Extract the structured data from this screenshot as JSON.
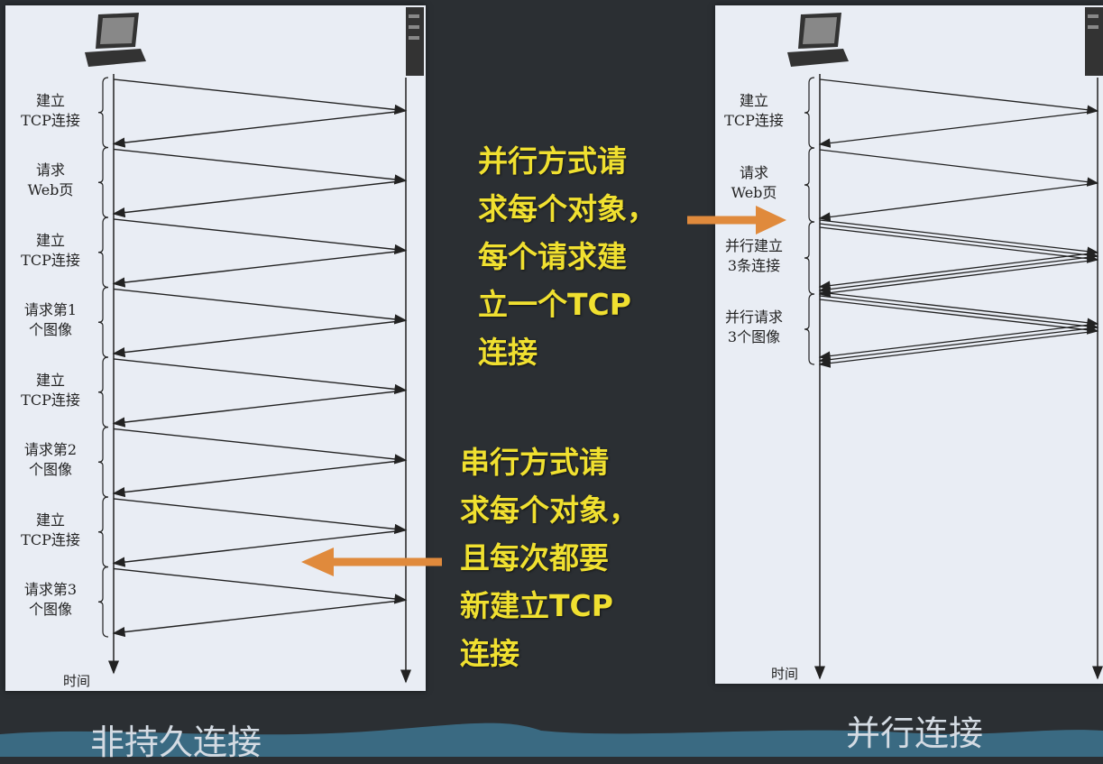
{
  "left_panel": {
    "steps": [
      {
        "label": "建立\nTCP连接"
      },
      {
        "label": "请求\nWeb页"
      },
      {
        "label": "建立\nTCP连接"
      },
      {
        "label": "请求第1\n个图像"
      },
      {
        "label": "建立\nTCP连接"
      },
      {
        "label": "请求第2\n个图像"
      },
      {
        "label": "建立\nTCP连接"
      },
      {
        "label": "请求第3\n个图像"
      }
    ],
    "time_label": "时间",
    "caption": "非持久连接"
  },
  "right_panel": {
    "steps": [
      {
        "label": "建立\nTCP连接"
      },
      {
        "label": "请求\nWeb页"
      },
      {
        "label": "并行建立\n3条连接"
      },
      {
        "label": "并行请求\n3个图像"
      }
    ],
    "time_label": "时间",
    "caption": "并行连接"
  },
  "annotations": {
    "parallel": [
      "并行方式请",
      "求每个对象，",
      "每个请求建",
      "立一个TCP",
      "连接"
    ],
    "serial": [
      "串行方式请",
      "求每个对象，",
      "且每次都要",
      "新建立TCP",
      "连接"
    ]
  },
  "colors": {
    "annotation_text": "#f0e030",
    "arrow": "#e08a3c",
    "background": "#2b2f33",
    "panel": "#e9edf4"
  },
  "icons": {
    "client": "computer-icon",
    "server": "server-icon"
  }
}
